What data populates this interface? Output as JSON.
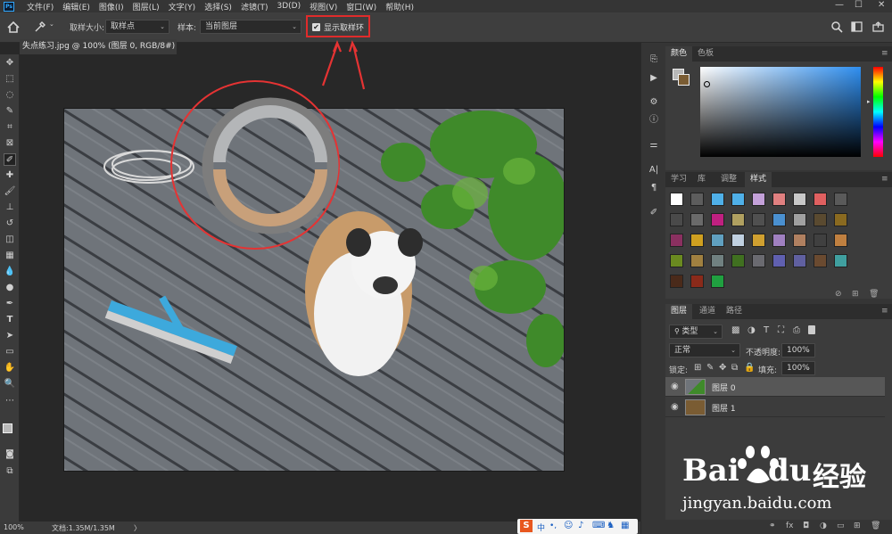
{
  "app": {
    "logo": "Ps",
    "menu": [
      "文件(F)",
      "编辑(E)",
      "图像(I)",
      "图层(L)",
      "文字(Y)",
      "选择(S)",
      "滤镜(T)",
      "3D(D)",
      "视图(V)",
      "窗口(W)",
      "帮助(H)"
    ],
    "window_controls": [
      "—",
      "☐",
      "✕"
    ]
  },
  "options_bar": {
    "sample_size_label": "取样大小:",
    "sample_size_value": "取样点",
    "sample_label": "样本:",
    "sample_value": "当前图层",
    "show_ring_label": "显示取样环",
    "show_ring_checked": true
  },
  "document": {
    "tab_title": "失点练习.jpg @ 100% (图层 0, RGB/8#) *",
    "close": "✕"
  },
  "status_bar": {
    "zoom": "100%",
    "doc_info": "文档:1.35M/1.35M",
    "arrow": "〉"
  },
  "color_panel": {
    "tabs": [
      "颜色",
      "色板"
    ],
    "active_tab": "颜色",
    "hue_base": "#2f8ff0"
  },
  "styles_panel": {
    "tabs": [
      "学习",
      "库",
      "调整",
      "样式"
    ],
    "active_tab": "样式",
    "swatch_colors": [
      "#ffffff",
      "#5d5d5d",
      "#4fb0e8",
      "#4fb0e8",
      "#c3a0d8",
      "#e08080",
      "#c8c8c8",
      "#e06060",
      "#5a5a5a",
      "#4a4a4a",
      "#6a6a6a",
      "#c02080",
      "#b0a060",
      "#505050",
      "#4a90d0",
      "#a0a0a0",
      "#5a4a30",
      "#8a6a20",
      "#8a3060",
      "#d0a020",
      "#60a0c0",
      "#c0d0e0",
      "#d0a030",
      "#a080c0",
      "#b08060",
      "#404040",
      "#c08040",
      "#6a8a20",
      "#a08040",
      "#708080",
      "#407020",
      "#6a6a70",
      "#6060b0",
      "#6060a0",
      "#6a4a30",
      "#40a0a0",
      "#4a2a1a",
      "#8a2a1a",
      "#20a040"
    ]
  },
  "layers_panel": {
    "tabs": [
      "图层",
      "通道",
      "路径"
    ],
    "active_tab": "图层",
    "filter_label": "类型",
    "blend_mode": "正常",
    "opacity_label": "不透明度:",
    "opacity_value": "100%",
    "lock_label": "锁定:",
    "fill_label": "填充:",
    "fill_value": "100%",
    "layers": [
      {
        "name": "图层 0",
        "selected": true
      },
      {
        "name": "图层 1",
        "selected": false
      }
    ]
  },
  "watermark": {
    "brand_a": "Bai",
    "brand_b": "du",
    "brand_cn": "经验",
    "url": "jingyan.baidu.com"
  },
  "ime_bar": {
    "logo": "S",
    "mode": "中"
  }
}
